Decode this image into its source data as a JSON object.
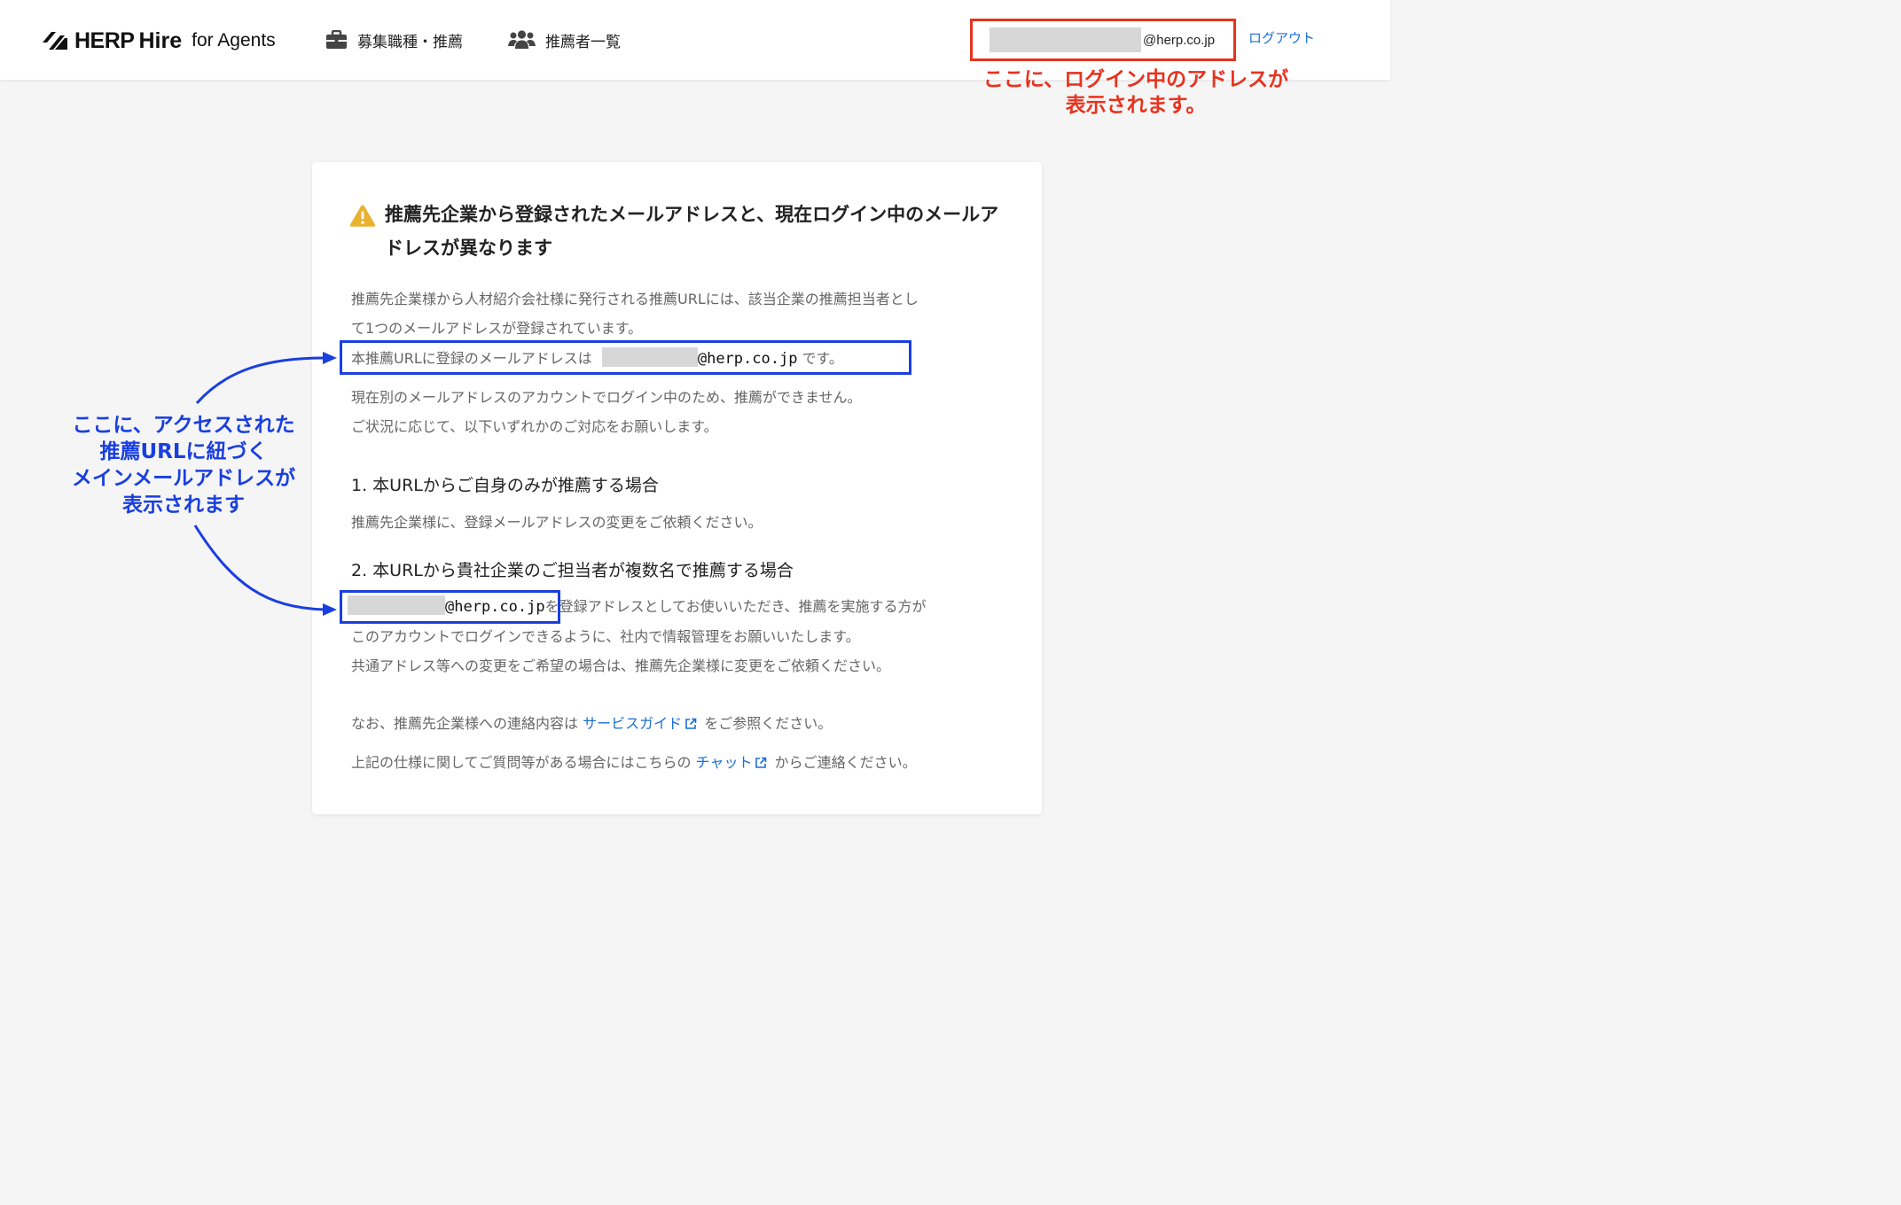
{
  "header": {
    "logo": {
      "brand": "HERP",
      "product": "Hire",
      "suffix": "for Agents"
    },
    "nav": [
      {
        "label": "募集職種・推薦",
        "icon": "briefcase-icon"
      },
      {
        "label": "推薦者一覧",
        "icon": "users-icon"
      }
    ],
    "account": {
      "email_domain": "@herp.co.jp"
    },
    "logout_label": "ログアウト"
  },
  "annotations": {
    "login_address_note": [
      "ここに、ログイン中のアドレスが",
      "表示されます。"
    ],
    "referral_address_note": [
      "ここに、アクセスされた",
      "推薦URLに紐づく",
      "メインメールアドレスが",
      "表示されます"
    ],
    "colors": {
      "red": "#e8321e",
      "blue": "#1a3fe0"
    }
  },
  "card": {
    "warning_icon": "warning-icon",
    "title": "推薦先企業から登録されたメールアドレスと、現在ログイン中のメールアドレスが異なります",
    "intro": [
      "推薦先企業様から人材紹介会社様に発行される推薦URLには、該当企業の推薦担当者とし",
      "て1つのメールアドレスが登録されています。"
    ],
    "registered_prefix": "本推薦URLに登録のメールアドレスは",
    "registered_domain": "@herp.co.jp",
    "registered_suffix": "です。",
    "notice": [
      "現在別のメールアドレスのアカウントでログイン中のため、推薦ができません。",
      "ご状況に応じて、以下いずれかのご対応をお願いします。"
    ],
    "option1": {
      "heading": "1. 本URLからご自身のみが推薦する場合",
      "body": "推薦先企業様に、登録メールアドレスの変更をご依頼ください。"
    },
    "option2": {
      "heading": "2. 本URLから貴社企業のご担当者が複数名で推薦する場合",
      "email_domain": "@herp.co.jp",
      "line1_rest": "を登録アドレスとしてお使いいただき、推薦を実施する方が",
      "line2": "このアカウントでログインできるように、社内で情報管理をお願いいたします。",
      "line3": "共通アドレス等への変更をご希望の場合は、推薦先企業様に変更をご依頼ください。"
    },
    "guide": {
      "prefix": "なお、推薦先企業様への連絡内容は",
      "link": "サービスガイド",
      "suffix": "をご参照ください。"
    },
    "chat": {
      "prefix": "上記の仕様に関してご質問等がある場合にはこちらの",
      "link": "チャット",
      "suffix": "からご連絡ください。"
    },
    "link_color": "#1a6fd6"
  }
}
